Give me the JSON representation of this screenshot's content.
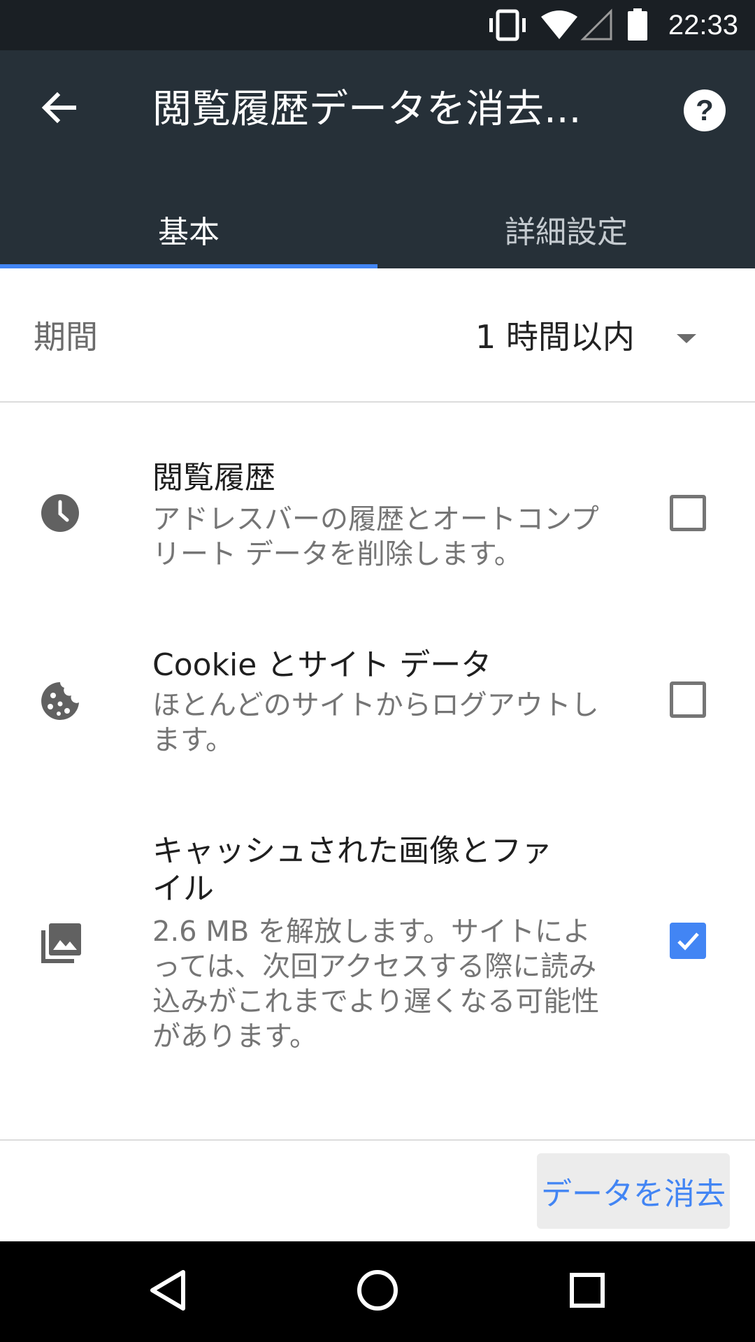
{
  "status_bar": {
    "time": "22:33",
    "icons": [
      "vibrate-icon",
      "wifi-icon",
      "cell-signal-icon",
      "battery-icon"
    ]
  },
  "app_bar": {
    "title": "閲覧履歴データを消去...",
    "back_icon": "arrow-back-icon",
    "help_icon": "help-icon"
  },
  "tabs": [
    {
      "label": "基本",
      "selected": true
    },
    {
      "label": "詳細設定",
      "selected": false
    }
  ],
  "period": {
    "label": "期間",
    "value": "1 時間以内"
  },
  "options": [
    {
      "icon": "clock-icon",
      "title": "閲覧履歴",
      "description_lines": [
        "アドレスバーの履歴とオートコンプ",
        "リート データを削除します。"
      ],
      "checked": false
    },
    {
      "icon": "cookie-icon",
      "title": "Cookie とサイト データ",
      "description_lines": [
        "ほとんどのサイトからログアウトし",
        "ます。"
      ],
      "checked": false
    },
    {
      "icon": "image-library-icon",
      "title_lines": [
        "キャッシュされた画像とファ",
        "イル"
      ],
      "description_lines": [
        "2.6 MB を解放します。サイトによ",
        "っては、次回アクセスする際に読み",
        "込みがこれまでより遅くなる可能性",
        "があります。"
      ],
      "checked": true
    }
  ],
  "clear_button": {
    "label": "データを消去"
  },
  "colors": {
    "accent": "#4285f4",
    "app_bar": "#263038",
    "status_bar": "#1a1f24"
  },
  "nav_bar": [
    "back-triangle-icon",
    "home-circle-icon",
    "recents-square-icon"
  ]
}
